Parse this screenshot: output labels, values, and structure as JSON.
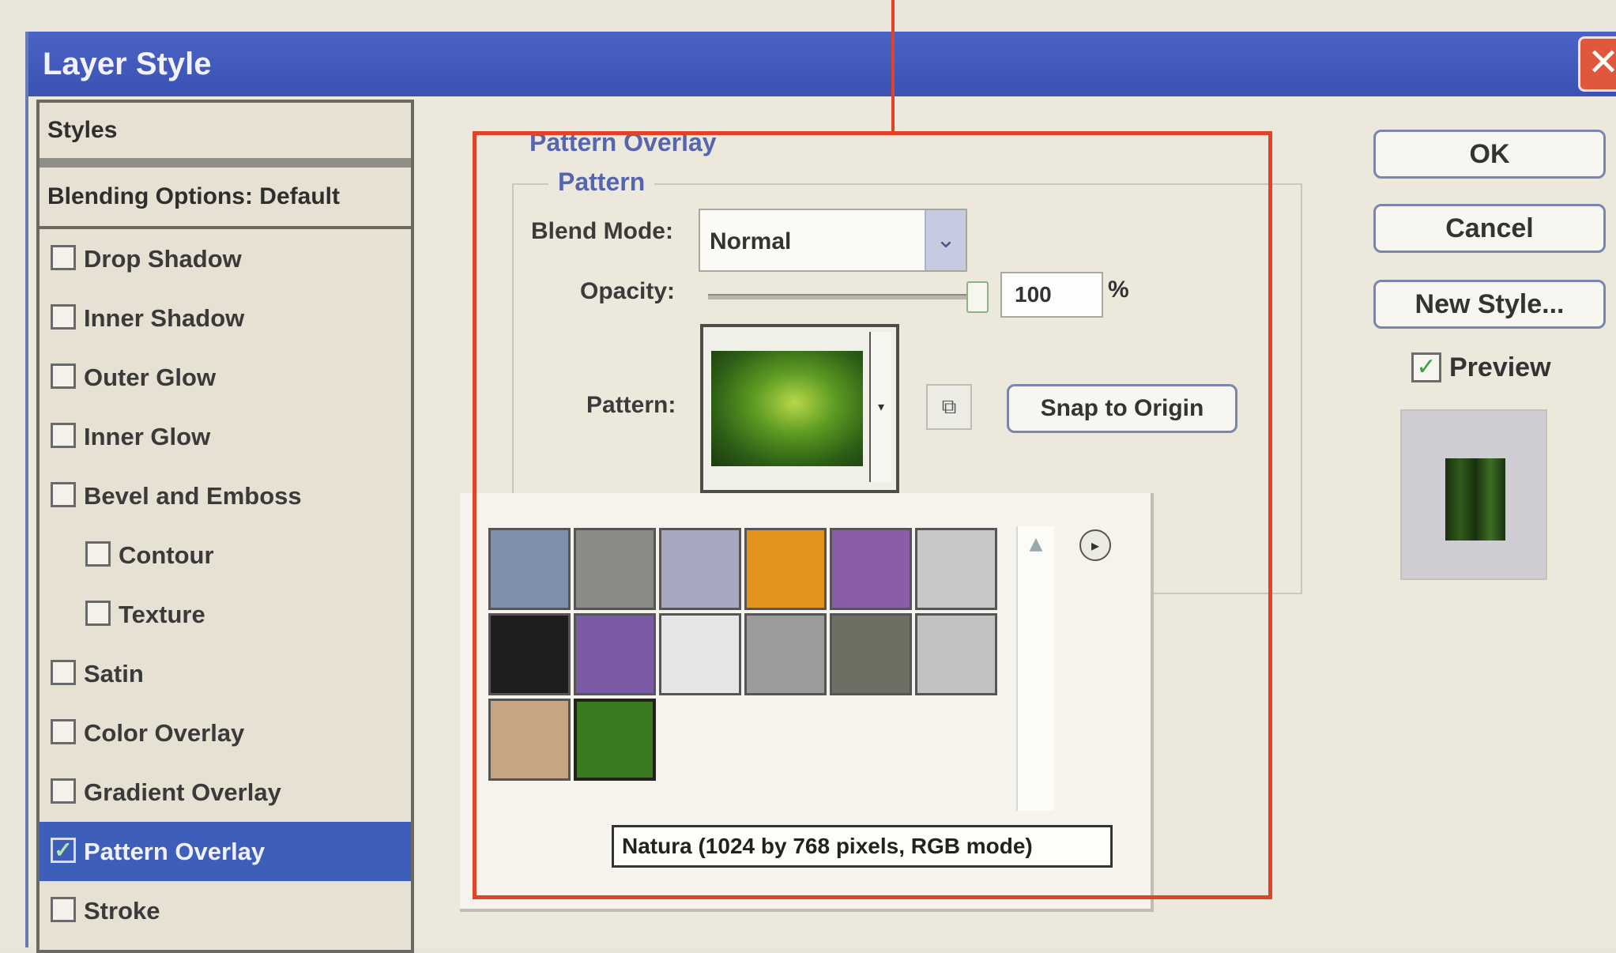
{
  "window": {
    "title": "Layer Style",
    "close_glyph": "✕"
  },
  "styles_panel": {
    "header": "Styles",
    "blending_options": "Blending Options: Default",
    "items": [
      {
        "label": "Drop Shadow",
        "checked": false
      },
      {
        "label": "Inner Shadow",
        "checked": false
      },
      {
        "label": "Outer Glow",
        "checked": false
      },
      {
        "label": "Inner Glow",
        "checked": false
      },
      {
        "label": "Bevel and Emboss",
        "checked": false
      },
      {
        "label": "Contour",
        "checked": false
      },
      {
        "label": "Texture",
        "checked": false
      },
      {
        "label": "Satin",
        "checked": false
      },
      {
        "label": "Color Overlay",
        "checked": false
      },
      {
        "label": "Gradient Overlay",
        "checked": false
      },
      {
        "label": "Pattern Overlay",
        "checked": true
      },
      {
        "label": "Stroke",
        "checked": false
      }
    ]
  },
  "pattern_overlay": {
    "section_title": "Pattern Overlay",
    "group_title": "Pattern",
    "blend_mode_label": "Blend Mode:",
    "blend_mode_value": "Normal",
    "opacity_label": "Opacity:",
    "opacity_value": "100",
    "opacity_unit": "%",
    "pattern_label": "Pattern:",
    "snap_button": "Snap to Origin"
  },
  "library": {
    "tooltip": "Natura (1024 by 768 pixels, RGB mode)",
    "swatch_colors": [
      "#7f90aa",
      "#8a8a86",
      "#a8a7c0",
      "#e2931b",
      "#8a5da8",
      "#c8c8c8",
      "#1e1e1e",
      "#7a5aa4",
      "#e6e6e6",
      "#9b9b9b",
      "#6e6e62",
      "#c2c2c2",
      "#c7a583",
      "#3a7b1f"
    ]
  },
  "buttons": {
    "ok": "OK",
    "cancel": "Cancel",
    "new_style": "New Style..."
  },
  "preview": {
    "label": "Preview",
    "checked": true
  }
}
